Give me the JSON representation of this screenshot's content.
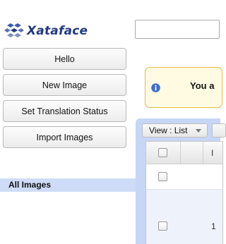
{
  "brand": {
    "name": "Xataface"
  },
  "search": {
    "placeholder": ""
  },
  "actions": [
    {
      "label": "Hello"
    },
    {
      "label": "New Image"
    },
    {
      "label": "Set Translation Status"
    },
    {
      "label": "Import Images"
    }
  ],
  "info": {
    "text": "You a"
  },
  "nav": {
    "all_images": "All Images"
  },
  "listing": {
    "view_selector": "View : List",
    "header_col": "I",
    "rows": [
      {
        "cell": ""
      },
      {
        "cell": "1"
      }
    ]
  },
  "colors": {
    "brand": "#233a7d",
    "selected_nav": "#cfdcf7",
    "panel": "#c7d6f5",
    "info_border": "#e8b84a",
    "info_bg": "#fffbe2"
  }
}
